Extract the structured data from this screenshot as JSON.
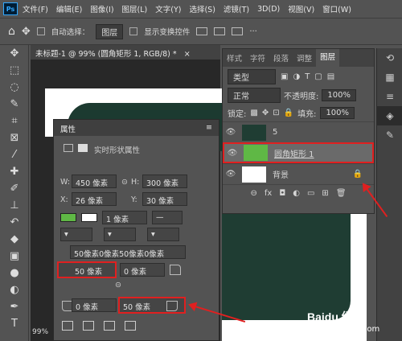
{
  "menu": {
    "app_icon": "Ps",
    "items": [
      "文件(F)",
      "编辑(E)",
      "图像(I)",
      "图层(L)",
      "文字(Y)",
      "选择(S)",
      "滤镜(T)",
      "3D(D)",
      "视图(V)",
      "窗口(W)"
    ]
  },
  "options": {
    "auto_select": "自动选择：",
    "auto_select_value": "图层",
    "show_transform": "显示变换控件",
    "more": "···"
  },
  "document": {
    "tab_title": "未标题-1 @ 99% (圆角矩形 1, RGB/8) *",
    "close": "×",
    "zoom": "99%"
  },
  "layers_panel": {
    "tabs": [
      "样式",
      "字符",
      "段落",
      "调整",
      "图层"
    ],
    "kind_filter": "类型",
    "blend_mode": "正常",
    "opacity_label": "不透明度:",
    "opacity_value": "100%",
    "lock_label": "锁定:",
    "fill_label": "填充:",
    "fill_value": "100%",
    "layers": [
      {
        "name": "5"
      },
      {
        "name": "圆角矩形 1"
      },
      {
        "name": "背景"
      }
    ]
  },
  "properties": {
    "title": "属性",
    "subtitle": "实时形状属性",
    "w_label": "W:",
    "w_value": "450 像素",
    "h_label": "H:",
    "h_value": "300 像素",
    "x_label": "X:",
    "x_value": "26 像素",
    "y_label": "Y:",
    "y_value": "30 像素",
    "stroke_width": "1 像素",
    "radius_all": "50像素0像素50像素0像素",
    "r_tl": "50 像素",
    "r_tr": "0 像素",
    "r_bl": "0 像素",
    "r_br": "50 像素"
  },
  "watermark": {
    "brand": "Baidu 经验",
    "url": "jingyan.baidu.com"
  },
  "colors": {
    "accent_red": "#e02020",
    "fill_green": "#5fb845",
    "panel_bg": "#535353"
  }
}
